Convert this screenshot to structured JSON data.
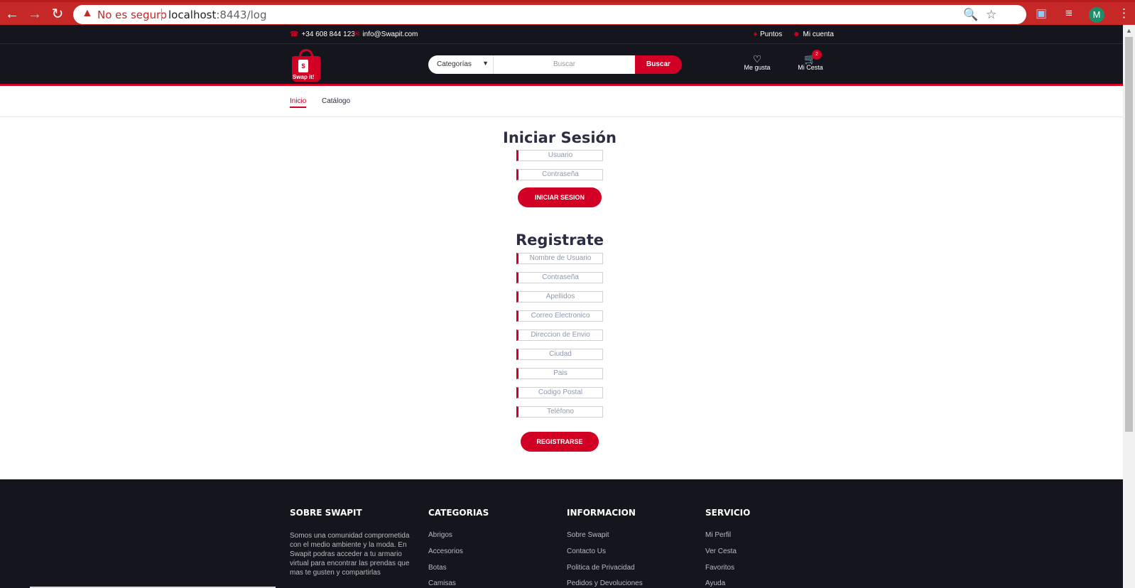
{
  "browser": {
    "security_label": "No es seguro",
    "url_host": "localhost",
    "url_path": ":8443/log",
    "profile_initial": "M"
  },
  "topbar": {
    "phone": "+34 608 844 123",
    "email": "info@Swapit.com",
    "points": "Puntos",
    "account": "Mi cuenta"
  },
  "header": {
    "logo_text": "Swap it!",
    "search": {
      "category": "Categorías",
      "placeholder": "Buscar",
      "button": "Buscar"
    },
    "wishlist": "Me gusta",
    "cart": "Mi Cesta",
    "cart_count": "2"
  },
  "nav": {
    "items": [
      "Inicio",
      "Catálogo"
    ]
  },
  "login": {
    "title": "Iniciar Sesión",
    "fields": [
      "Usuario",
      "Contraseña"
    ],
    "button": "INICIAR SESION"
  },
  "register": {
    "title": "Registrate",
    "fields": [
      "Nombre de Usuario",
      "Contraseña",
      "Apellidos",
      "Correo Electronico",
      "Direccion de Envio",
      "Ciudad",
      "Pais",
      "Codigo Postal",
      "Teléfono"
    ],
    "button": "REGISTRARSE"
  },
  "footer": {
    "about_title": "SOBRE SWAPIT",
    "about_text": "Somos una comunidad comprometida con el medio ambiente y la moda. En Swapit podras acceder a tu armario virtual para encontrar las prendas que mas te gusten y compartirlas",
    "categories_title": "CATEGORIAS",
    "categories": [
      "Abrigos",
      "Accesorios",
      "Botas",
      "Camisas"
    ],
    "info_title": "INFORMACION",
    "info": [
      "Sobre Swapit",
      "Contacto Us",
      "Politica de Privacidad",
      "Pedidos y Devoluciones"
    ],
    "service_title": "SERVICIO",
    "service": [
      "Mi Perfil",
      "Ver Cesta",
      "Favoritos",
      "Ayuda"
    ]
  },
  "colors": {
    "accent": "#d10024",
    "dark": "#15161d",
    "browser_bar": "#c62828"
  }
}
